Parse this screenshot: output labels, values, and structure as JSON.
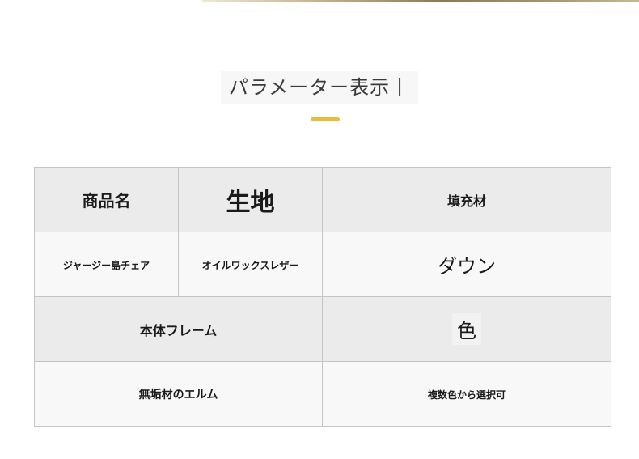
{
  "header": {
    "title": "パラメーター表示丨"
  },
  "colors": {
    "accent_underline": "#e8bc3c",
    "header_cell_bg": "#ebebeb",
    "value_cell_bg": "#f8f8f8",
    "border": "#c4c4c4"
  },
  "table": {
    "row1": {
      "col1": "商品名",
      "col2": "生地",
      "col3": "填充材"
    },
    "row2": {
      "col1": "ジャージー島チェア",
      "col2": "オイルワックスレザー",
      "col3": "ダウン"
    },
    "row3": {
      "col1": "本体フレーム",
      "col2": "色"
    },
    "row4": {
      "col1": "無垢材のエルム",
      "col2": "複数色から選択可"
    }
  }
}
